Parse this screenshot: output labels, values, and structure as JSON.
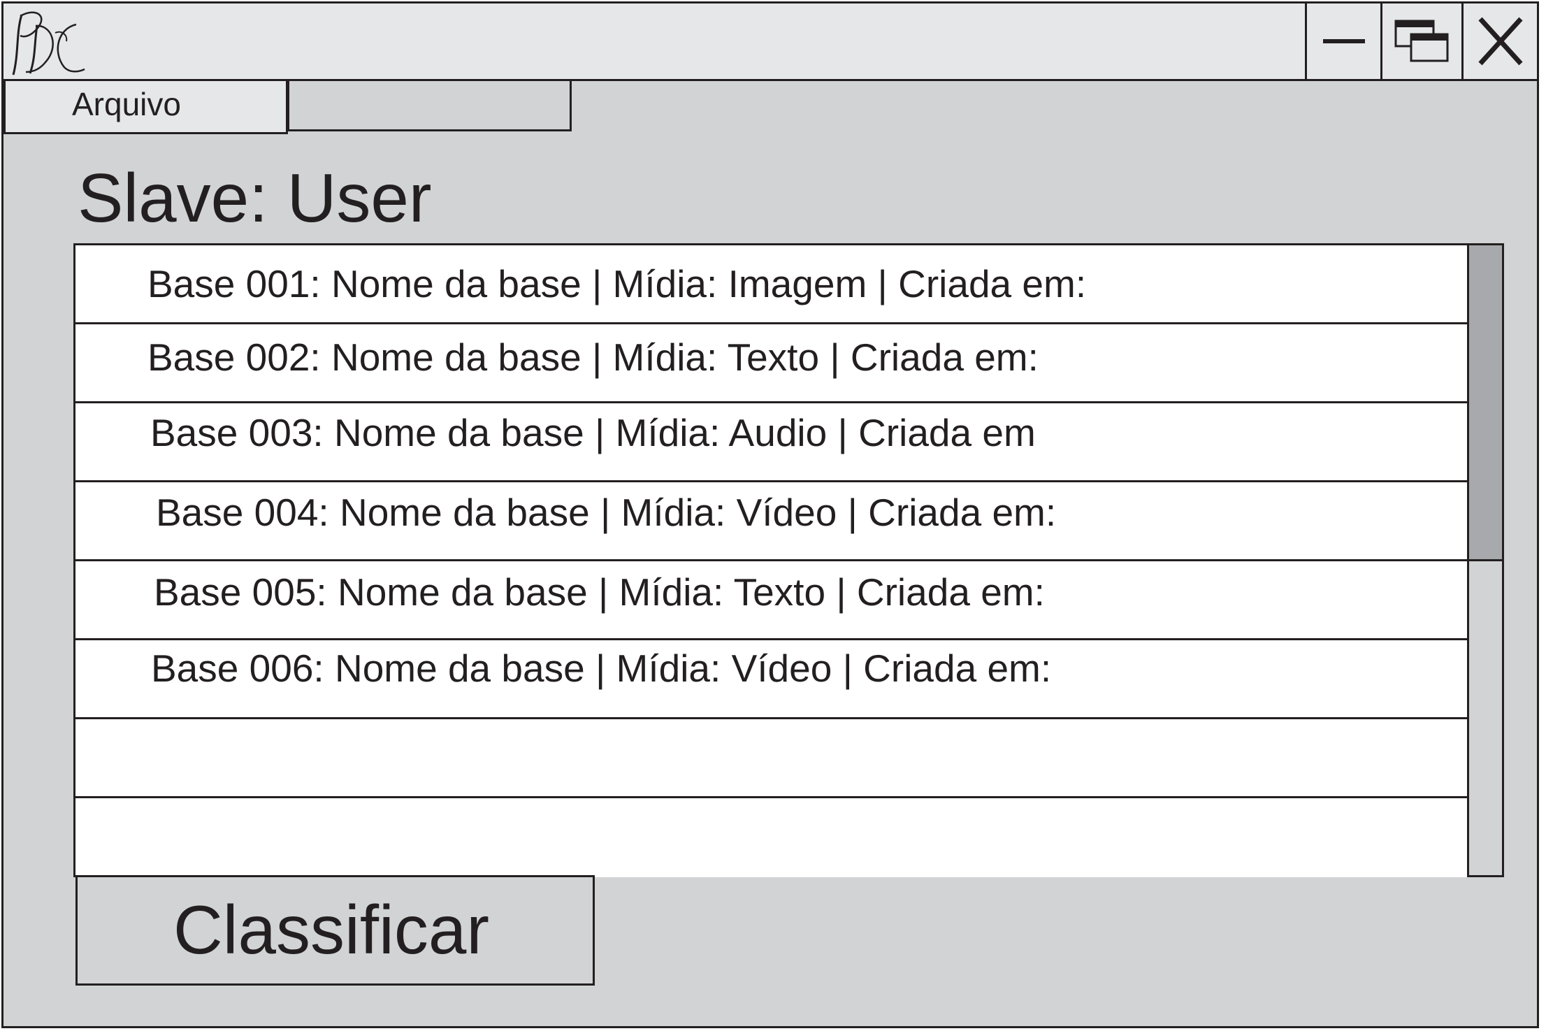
{
  "window": {
    "title": "",
    "logo": "PDC monogram logo",
    "controls": {
      "minimize": "minimize-icon",
      "maximize": "restore-windows-icon",
      "close": "X"
    }
  },
  "menu": {
    "items": [
      "Arquivo",
      ""
    ]
  },
  "page": {
    "title": "Slave: User"
  },
  "bases_list": {
    "rows": [
      "Base 001: Nome da base | Mídia: Imagem | Criada em:",
      "Base 002: Nome da base | Mídia: Texto | Criada em:",
      "Base 003: Nome da base | Mídia: Audio | Criada em",
      "Base 004: Nome da base | Mídia: Vídeo | Criada em:",
      "Base 005: Nome da base | Mídia: Texto | Criada em:",
      "Base 006: Nome da base | Mídia: Vídeo | Criada em:",
      "",
      ""
    ],
    "scroll_position_fraction": 0
  },
  "actions": {
    "classify_label": "Classificar"
  },
  "colors": {
    "window_bg": "#d1d3d4",
    "titlebar_bg": "#e6e7e8",
    "border": "#231f20",
    "scroll_thumb": "#a7a9ac",
    "list_bg": "#ffffff"
  }
}
